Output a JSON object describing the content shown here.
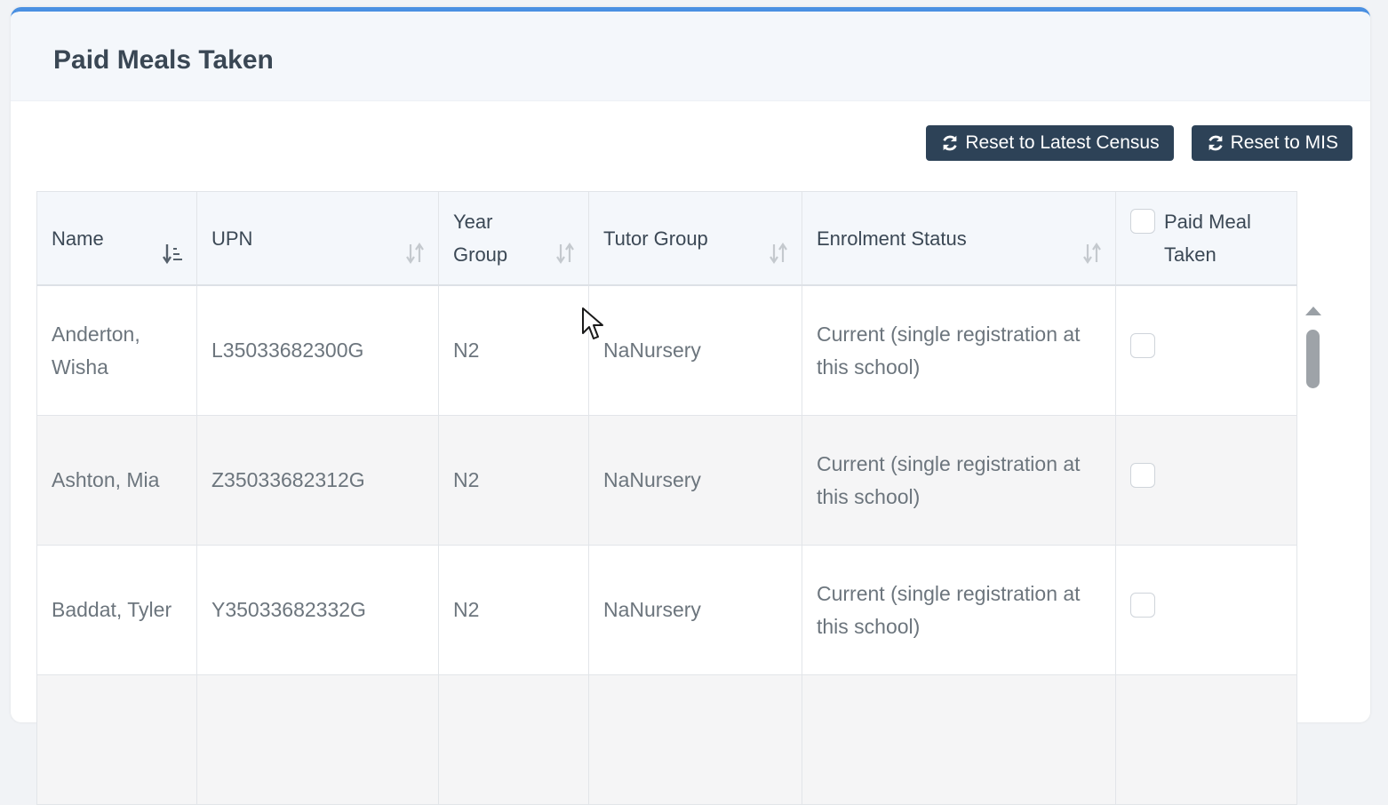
{
  "panel": {
    "title": "Paid Meals Taken"
  },
  "toolbar": {
    "reset_census_label": "Reset to Latest Census",
    "reset_mis_label": "Reset to MIS",
    "refresh_icon": "refresh-icon"
  },
  "table": {
    "columns": {
      "name": "Name",
      "upn": "UPN",
      "year_group": "Year Group",
      "tutor_group": "Tutor Group",
      "enrolment_status": "Enrolment Status",
      "paid_meal_taken": "Paid Meal Taken"
    },
    "sort": {
      "active_column": "name",
      "direction": "ascending"
    },
    "rows": [
      {
        "name": "Anderton, Wisha",
        "upn": "L35033682300G",
        "year_group": "N2",
        "tutor_group": "NaNursery",
        "enrolment_status": "Current (single registration at this school)",
        "paid_meal_taken": false
      },
      {
        "name": "Ashton, Mia",
        "upn": "Z35033682312G",
        "year_group": "N2",
        "tutor_group": "NaNursery",
        "enrolment_status": "Current (single registration at this school)",
        "paid_meal_taken": false
      },
      {
        "name": "Baddat, Tyler",
        "upn": "Y35033682332G",
        "year_group": "N2",
        "tutor_group": "NaNursery",
        "enrolment_status": "Current (single registration at this school)",
        "paid_meal_taken": false
      }
    ]
  },
  "colors": {
    "accent_top_border": "#4a90e2",
    "button_bg": "#2d4257",
    "header_bg": "#f4f7fb"
  }
}
